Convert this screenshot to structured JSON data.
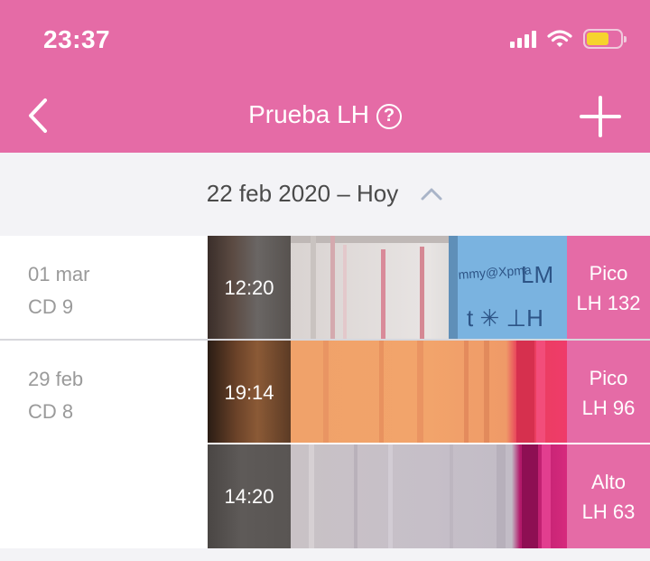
{
  "status_bar": {
    "time": "23:37"
  },
  "nav": {
    "title": "Prueba LH",
    "help_glyph": "?",
    "back_icon": "chevron-left-icon",
    "add_icon": "plus-icon"
  },
  "range": {
    "label": "22 feb 2020 – Hoy",
    "toggle_icon": "chevron-up-icon"
  },
  "entries": [
    {
      "date": "01 mar",
      "cycle_day": "CD 9",
      "time": "12:20",
      "status": "Pico",
      "value": "LH 132"
    },
    {
      "date": "29 feb",
      "cycle_day": "CD 8",
      "time": "19:14",
      "status": "Pico",
      "value": "LH 96"
    },
    {
      "date": "",
      "cycle_day": "",
      "time": "14:20",
      "status": "Alto",
      "value": "LH 63"
    }
  ],
  "colors": {
    "brand_pink": "#e56ba6",
    "background": "#f3f3f6",
    "muted_text": "#9a9a9a"
  }
}
